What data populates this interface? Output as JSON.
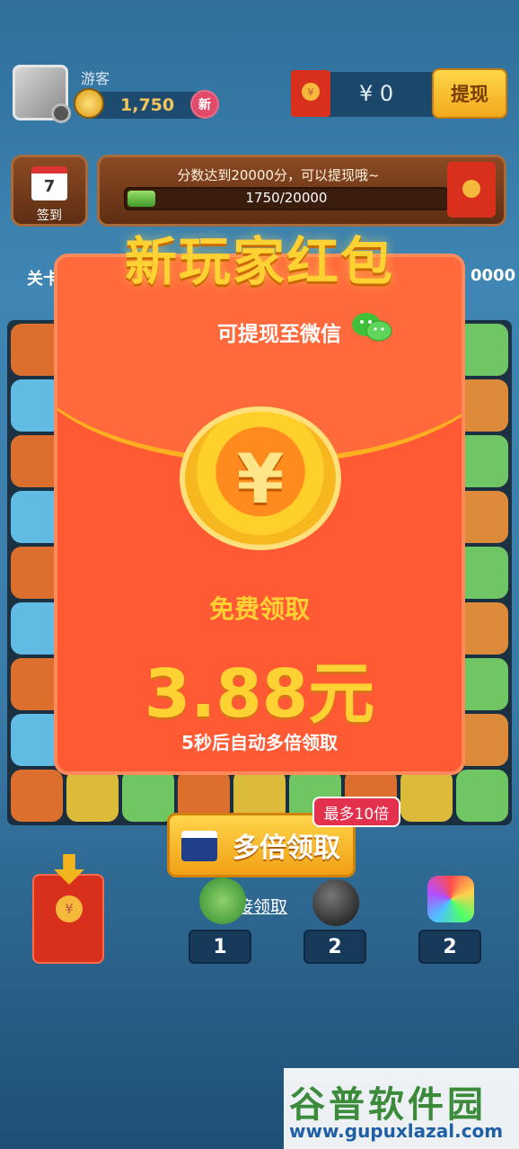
{
  "header": {
    "username": "游客",
    "score": "1,750",
    "new_badge": "新",
    "cash": "¥ 0",
    "withdraw_label": "提现"
  },
  "checkin": {
    "day": "7",
    "label": "签到"
  },
  "progress": {
    "tip": "分数达到20000分，可以提现哦~",
    "text": "1750/20000",
    "fraction": 0.0875
  },
  "level": {
    "left_text": "关卡",
    "right_text": "0000"
  },
  "modal": {
    "title": "新玩家红包",
    "wechat_text": "可提现至微信",
    "coin_symbol": "¥",
    "free_label": "免费领取",
    "amount": "3.88元",
    "auto_text": "5秒后自动多倍领取",
    "multi_button": "多倍领取",
    "max_badge": "最多10倍",
    "direct_link": "直接领取"
  },
  "tools": {
    "counts": [
      "1",
      "2",
      "2"
    ]
  },
  "watermark": {
    "title": "谷普软件园",
    "url": "www.gupuxlazal.com"
  },
  "colors": {
    "envelope": "#ff5a33",
    "gold": "#ffd233",
    "button": "#f2a015",
    "badge": "#e3304c"
  }
}
